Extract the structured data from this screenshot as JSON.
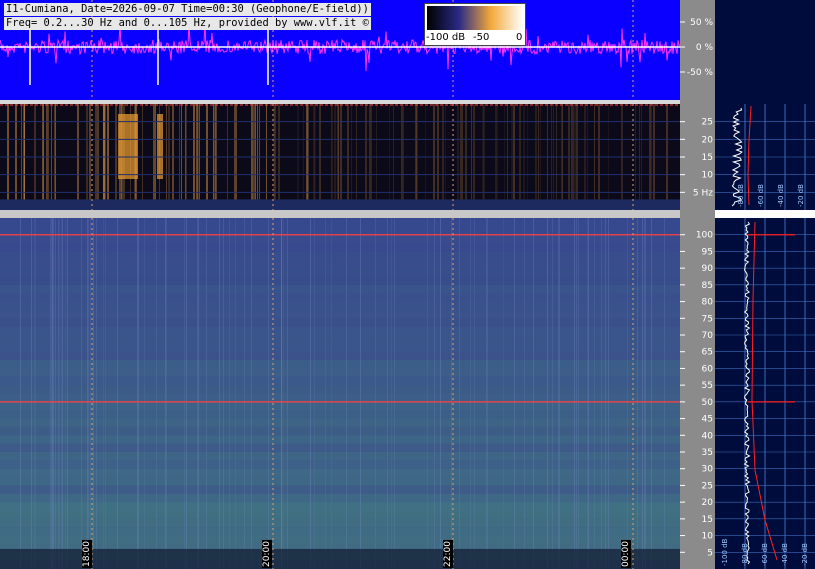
{
  "header": {
    "line1": "I1-Cumiana, Date=2026-09-07 Time=00:30 (Geophone/E-field))",
    "line2": "Freq= 0.2...30 Hz and 0...105 Hz, provided by www.vlf.it ©"
  },
  "colorbar": {
    "labels": [
      "-100 dB",
      "-50",
      "0"
    ],
    "colors": [
      "#000000",
      "#2b2a86",
      "#f4a93b",
      "#ffffff"
    ]
  },
  "colors": {
    "waveform_bg": "#0a00ff",
    "waveform_trace": "#ff33ff",
    "spectrogram_top_bg": "#0c0a18",
    "spectrogram_main_bg": "#3c4690",
    "axis_bg": "#8b8b8b",
    "side_bg": "#000c3c",
    "grid_line": "#e0a070",
    "hum_line": "#ff4040",
    "profile_trace": "#ffffff",
    "profile_red": "#ff2020",
    "side_grid": "#3a6ab8"
  },
  "chart_data": [
    {
      "type": "line",
      "panel": "waveform",
      "ytick_labels": [
        "50 %",
        "0 %",
        "-50 %"
      ],
      "ytick_values": [
        50,
        0,
        -50
      ],
      "ylim": [
        -100,
        100
      ]
    },
    {
      "type": "heatmap",
      "panel": "spectrogram-0-30hz",
      "ytick_labels": [
        "25",
        "20",
        "15",
        "10",
        "5 Hz"
      ],
      "ytick_values": [
        25,
        20,
        15,
        10,
        5
      ],
      "ylim": [
        0,
        30
      ]
    },
    {
      "type": "heatmap",
      "panel": "spectrogram-0-105hz",
      "ytick_labels": [
        "100",
        "95",
        "90",
        "85",
        "80",
        "75",
        "70",
        "65",
        "60",
        "55",
        "50",
        "45",
        "40",
        "35",
        "30",
        "25",
        "20",
        "15",
        "10",
        "5"
      ],
      "ytick_values": [
        100,
        95,
        90,
        85,
        80,
        75,
        70,
        65,
        60,
        55,
        50,
        45,
        40,
        35,
        30,
        25,
        20,
        15,
        10,
        5
      ],
      "ylim": [
        0,
        105
      ],
      "hum_lines_hz": [
        50,
        100
      ],
      "time_labels": [
        "18:00",
        "20:00",
        "22:00",
        "00:00"
      ]
    },
    {
      "type": "line",
      "panel": "side-profile-top",
      "xtick_labels": [
        "-80 dB",
        "-60 dB",
        "-40 dB",
        "-20 dB"
      ]
    },
    {
      "type": "line",
      "panel": "side-profile-main",
      "xtick_labels": [
        "-100 dB",
        "-80 dB",
        "-60 dB",
        "-40 dB",
        "-20 dB"
      ]
    }
  ]
}
